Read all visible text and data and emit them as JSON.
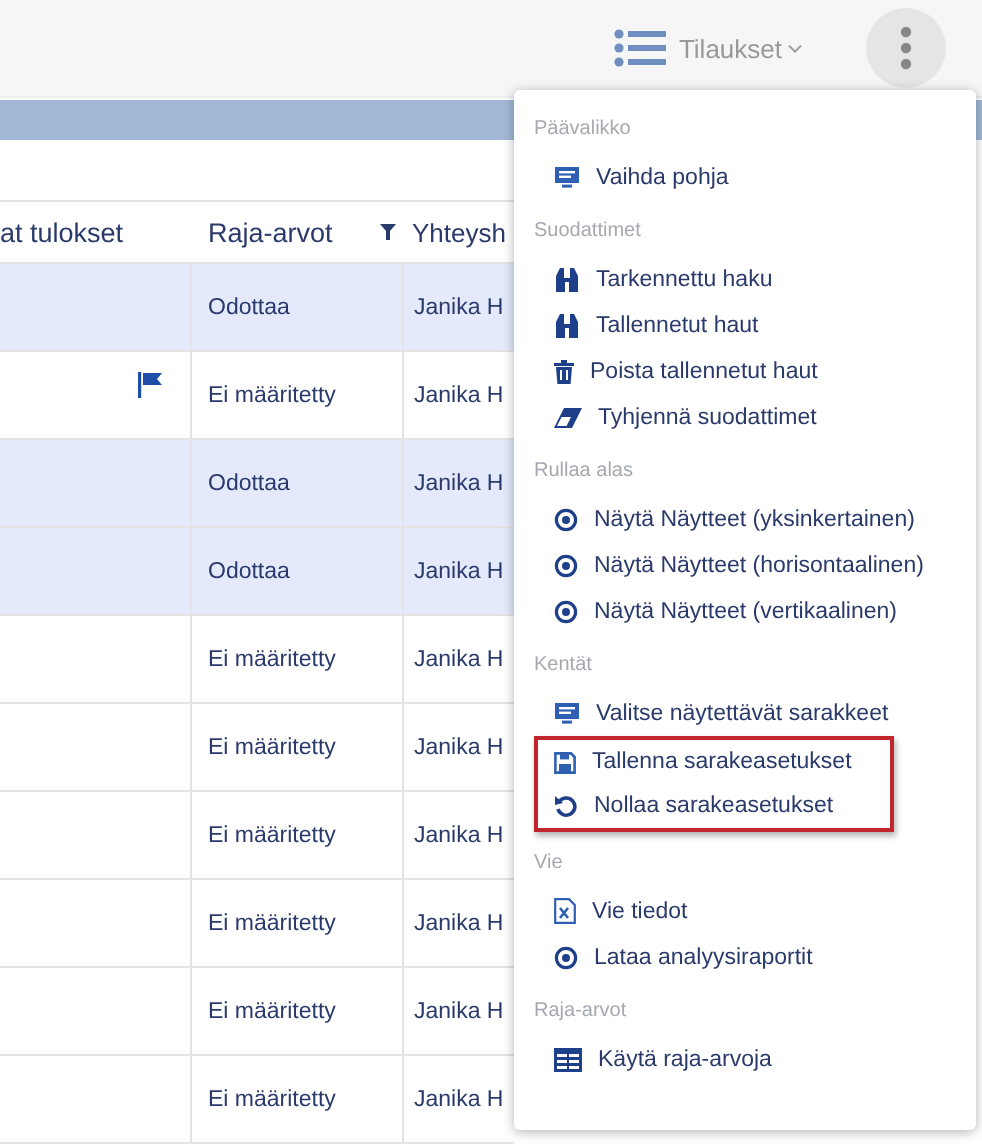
{
  "topbar": {
    "orders_label": "Tilaukset"
  },
  "table": {
    "columns": [
      {
        "label": "at tulokset"
      },
      {
        "label": "Raja-arvot",
        "filter": true
      },
      {
        "label": "Yhteysh"
      }
    ],
    "rows": [
      {
        "selected": true,
        "flag": false,
        "limit": "Odottaa",
        "contact": "Janika H"
      },
      {
        "selected": false,
        "flag": true,
        "limit": "Ei määritetty",
        "contact": "Janika H"
      },
      {
        "selected": true,
        "flag": false,
        "limit": "Odottaa",
        "contact": "Janika H"
      },
      {
        "selected": true,
        "flag": false,
        "limit": "Odottaa",
        "contact": "Janika H"
      },
      {
        "selected": false,
        "flag": false,
        "limit": "Ei määritetty",
        "contact": "Janika H"
      },
      {
        "selected": false,
        "flag": false,
        "limit": "Ei määritetty",
        "contact": "Janika H"
      },
      {
        "selected": false,
        "flag": false,
        "limit": "Ei määritetty",
        "contact": "Janika H"
      },
      {
        "selected": false,
        "flag": false,
        "limit": "Ei määritetty",
        "contact": "Janika H"
      },
      {
        "selected": false,
        "flag": false,
        "limit": "Ei määritetty",
        "contact": "Janika H"
      },
      {
        "selected": false,
        "flag": false,
        "limit": "Ei määritetty",
        "contact": "Janika H"
      }
    ]
  },
  "menu": {
    "sections": [
      {
        "title": "Päävalikko",
        "items": [
          {
            "kind": "monitor",
            "label": "Vaihda pohja",
            "highlighted": false
          }
        ]
      },
      {
        "title": "Suodattimet",
        "items": [
          {
            "kind": "binoculars",
            "label": "Tarkennettu haku",
            "highlighted": false
          },
          {
            "kind": "binoculars",
            "label": "Tallennetut haut",
            "highlighted": false
          },
          {
            "kind": "trash",
            "label": "Poista tallennetut haut",
            "highlighted": false
          },
          {
            "kind": "eraser",
            "label": "Tyhjennä suodattimet",
            "highlighted": false
          }
        ]
      },
      {
        "title": "Rullaa alas",
        "items": [
          {
            "kind": "target",
            "label": "Näytä Näytteet (yksinkertainen)",
            "highlighted": false
          },
          {
            "kind": "target",
            "label": "Näytä Näytteet (horisontaalinen)",
            "highlighted": false
          },
          {
            "kind": "target",
            "label": "Näytä Näytteet (vertikaalinen)",
            "highlighted": false
          }
        ]
      },
      {
        "title": "Kentät",
        "items": [
          {
            "kind": "monitor",
            "label": "Valitse näytettävät sarakkeet",
            "highlighted": false
          },
          {
            "kind": "save",
            "label": "Tallenna sarakeasetukset",
            "highlighted": true
          },
          {
            "kind": "reset",
            "label": "Nollaa sarakeasetukset",
            "highlighted": true
          }
        ]
      },
      {
        "title": "Vie",
        "items": [
          {
            "kind": "excel",
            "label": "Vie tiedot",
            "highlighted": false
          },
          {
            "kind": "target",
            "label": "Lataa analyysiraportit",
            "highlighted": false
          }
        ]
      },
      {
        "title": "Raja-arvot",
        "items": [
          {
            "kind": "grid",
            "label": "Käytä raja-arvoja",
            "highlighted": false
          }
        ]
      }
    ]
  }
}
